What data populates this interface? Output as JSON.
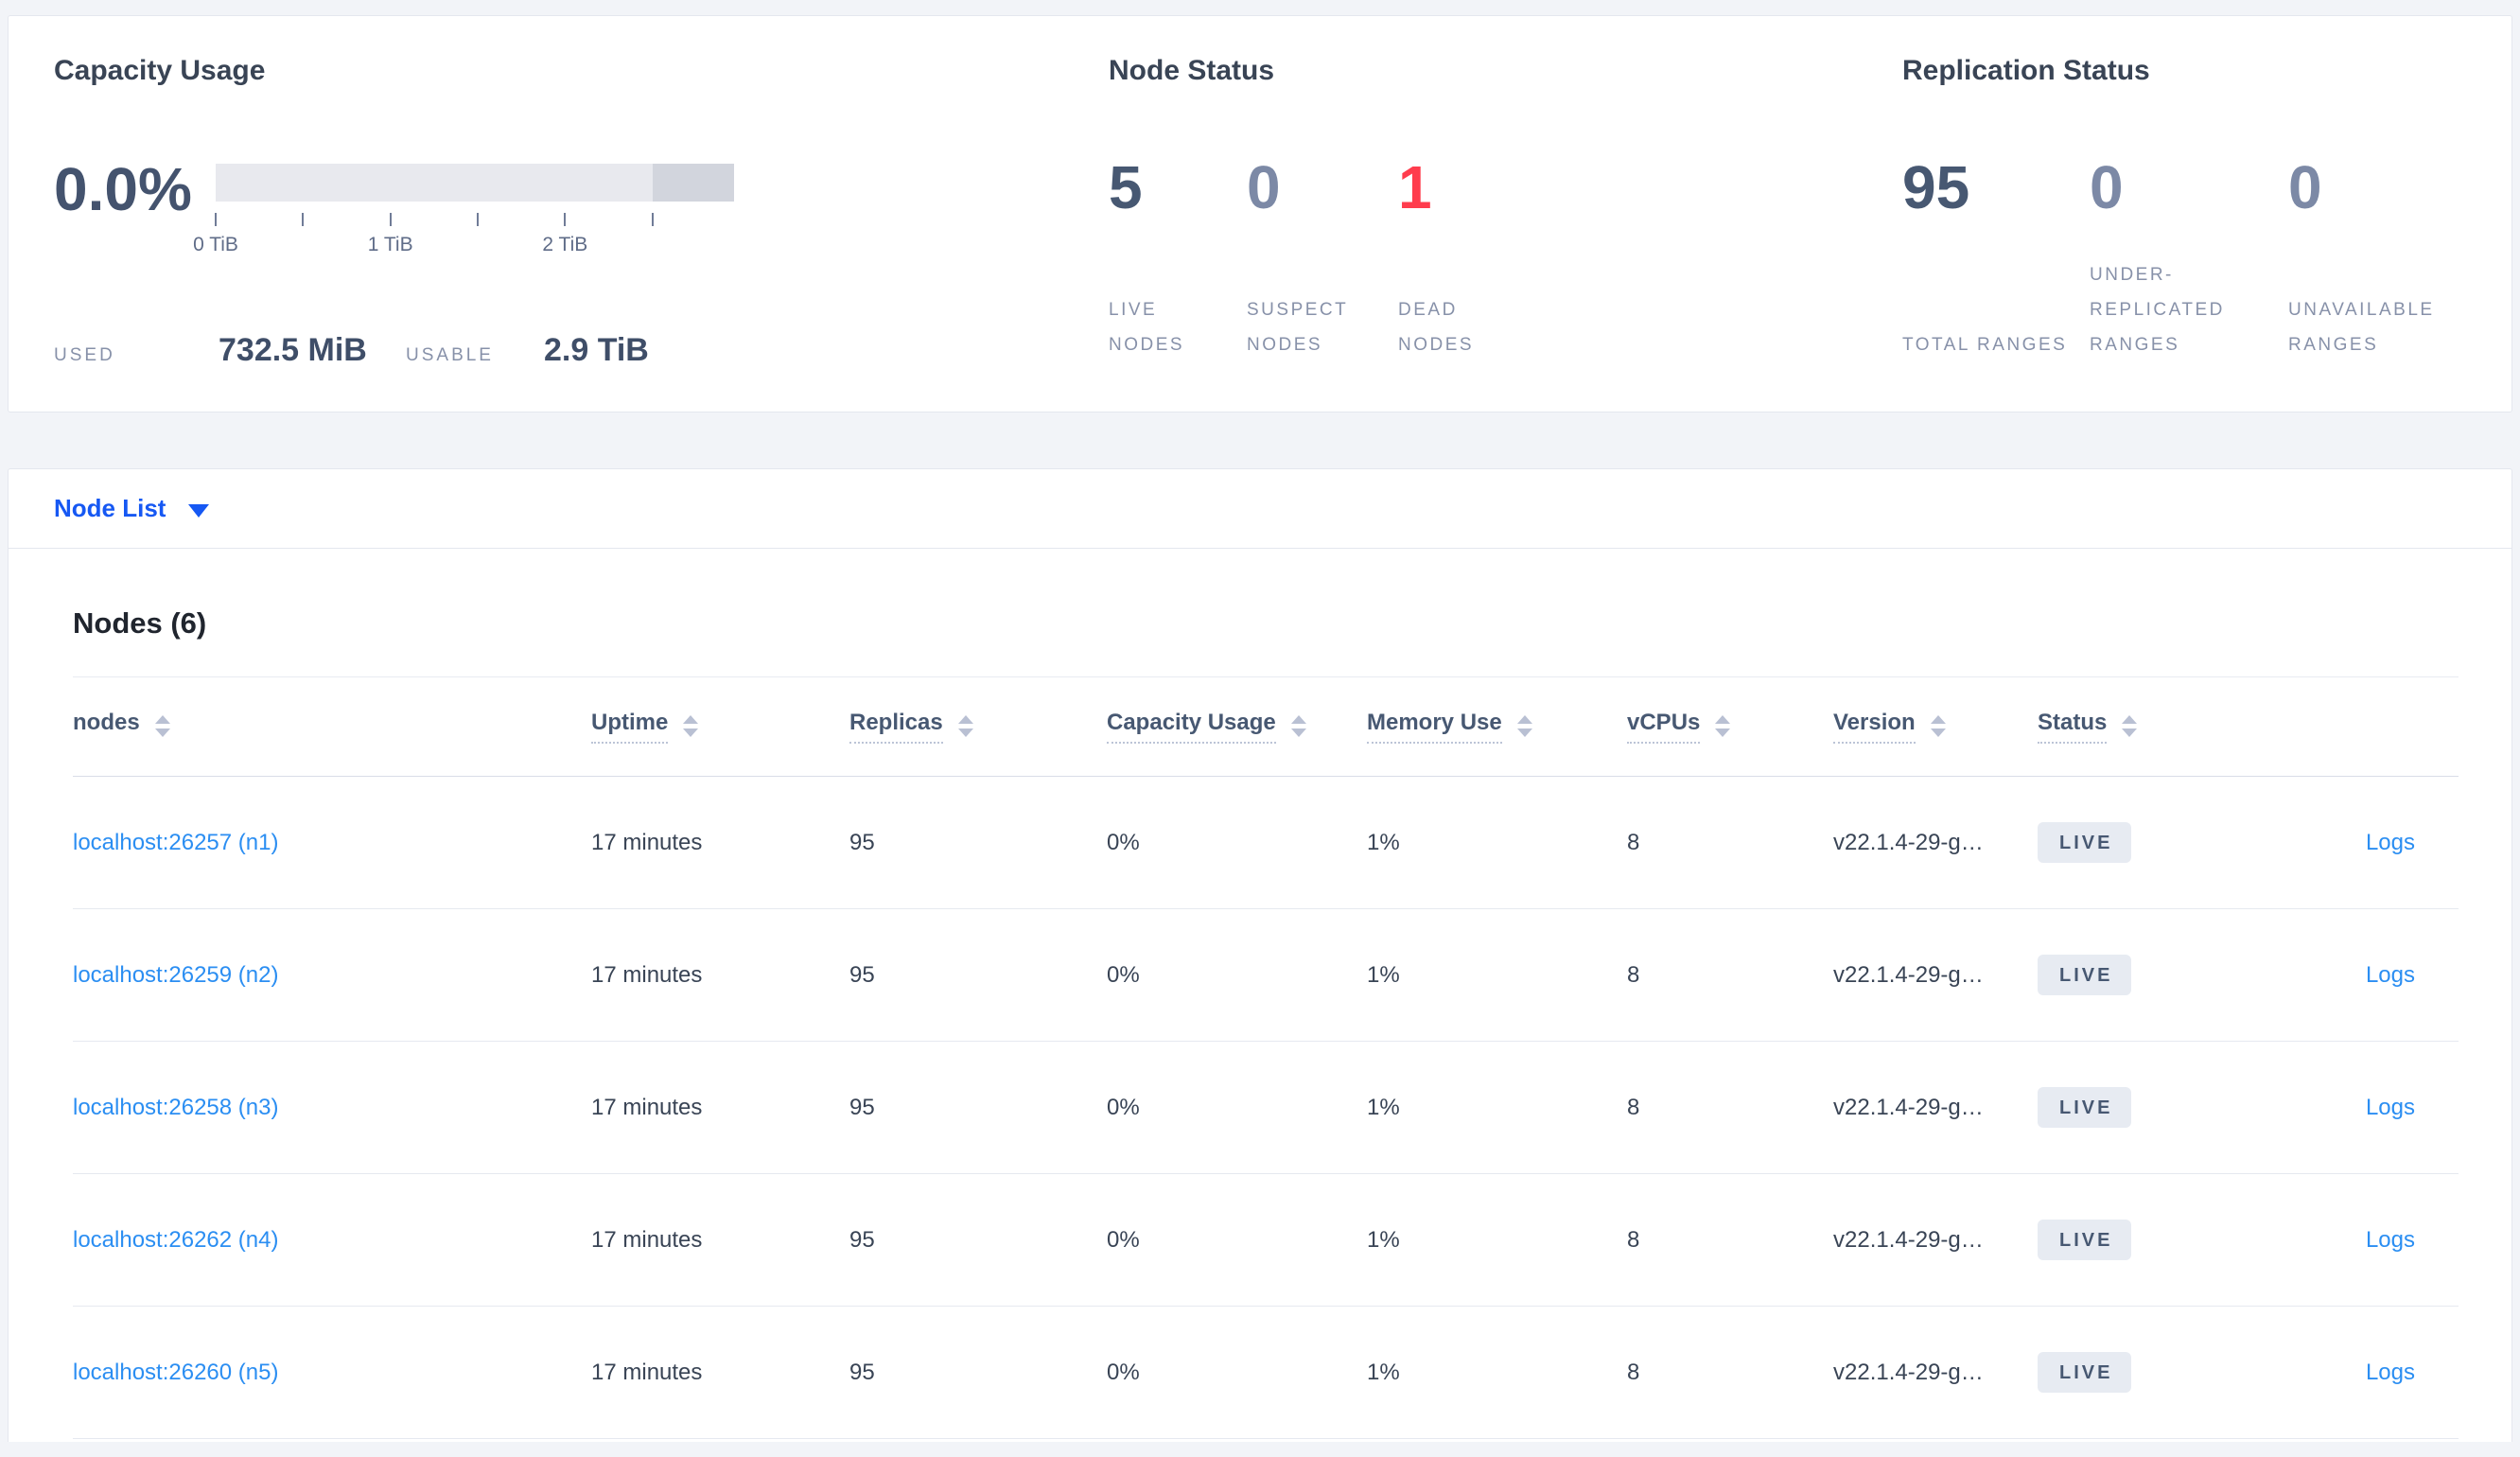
{
  "colors": {
    "selector_blue": "#1658f3",
    "link_blue": "#2b8ef2",
    "dead_red": "#ff3c4d",
    "stat_dark": "#475872",
    "stat_muted": "#7c89a6"
  },
  "summary": {
    "capacity": {
      "title": "Capacity Usage",
      "percent_used": "0.0%",
      "used_label": "USED",
      "used_value": "732.5 MiB",
      "usable_label": "USABLE",
      "usable_value": "2.9 TiB",
      "bar": {
        "light_color": "#e8e9ee",
        "dark_color": "#d2d5dd",
        "light_percent": 84.3,
        "dark_percent": 15.7
      },
      "ticks": [
        {
          "pos": 0,
          "label": "0 TiB"
        },
        {
          "pos": 16.85
        },
        {
          "pos": 33.7,
          "label": "1 TiB"
        },
        {
          "pos": 50.55
        },
        {
          "pos": 67.4,
          "label": "2 TiB"
        },
        {
          "pos": 84.3
        }
      ]
    },
    "node_status": {
      "title": "Node Status",
      "stats": [
        {
          "value": "5",
          "label": "LIVE NODES",
          "color": "#475872"
        },
        {
          "value": "0",
          "label": "SUSPECT NODES",
          "color": "#7c89a6"
        },
        {
          "value": "1",
          "label": "DEAD NODES",
          "color": "#ff3c4d"
        }
      ]
    },
    "replication": {
      "title": "Replication Status",
      "stats": [
        {
          "value": "95",
          "label": "TOTAL RANGES",
          "color": "#475872"
        },
        {
          "value": "0",
          "label": "UNDER-REPLICATED RANGES",
          "color": "#7c89a6"
        },
        {
          "value": "0",
          "label": "UNAVAILABLE RANGES",
          "color": "#7c89a6"
        }
      ]
    }
  },
  "view_selector": {
    "label": "Node List"
  },
  "nodes": {
    "title": "Nodes (6)",
    "columns": [
      {
        "label": "nodes",
        "underline": false,
        "sortable": true
      },
      {
        "label": "Uptime",
        "underline": true,
        "sortable": true
      },
      {
        "label": "Replicas",
        "underline": true,
        "sortable": true
      },
      {
        "label": "Capacity Usage",
        "underline": true,
        "sortable": true
      },
      {
        "label": "Memory Use",
        "underline": true,
        "sortable": true
      },
      {
        "label": "vCPUs",
        "underline": true,
        "sortable": true
      },
      {
        "label": "Version",
        "underline": true,
        "sortable": true
      },
      {
        "label": "Status",
        "underline": true,
        "sortable": true
      },
      {
        "label": "",
        "underline": false,
        "sortable": false
      }
    ],
    "rows": [
      {
        "address": "localhost:26257 (n1)",
        "uptime": "17 minutes",
        "replicas": "95",
        "capacity": "0%",
        "memory": "1%",
        "vcpus": "8",
        "version": "v22.1.4-29-g…",
        "status": "LIVE",
        "logs": "Logs"
      },
      {
        "address": "localhost:26259 (n2)",
        "uptime": "17 minutes",
        "replicas": "95",
        "capacity": "0%",
        "memory": "1%",
        "vcpus": "8",
        "version": "v22.1.4-29-g…",
        "status": "LIVE",
        "logs": "Logs"
      },
      {
        "address": "localhost:26258 (n3)",
        "uptime": "17 minutes",
        "replicas": "95",
        "capacity": "0%",
        "memory": "1%",
        "vcpus": "8",
        "version": "v22.1.4-29-g…",
        "status": "LIVE",
        "logs": "Logs"
      },
      {
        "address": "localhost:26262 (n4)",
        "uptime": "17 minutes",
        "replicas": "95",
        "capacity": "0%",
        "memory": "1%",
        "vcpus": "8",
        "version": "v22.1.4-29-g…",
        "status": "LIVE",
        "logs": "Logs"
      },
      {
        "address": "localhost:26260 (n5)",
        "uptime": "17 minutes",
        "replicas": "95",
        "capacity": "0%",
        "memory": "1%",
        "vcpus": "8",
        "version": "v22.1.4-29-g…",
        "status": "LIVE",
        "logs": "Logs"
      }
    ]
  }
}
